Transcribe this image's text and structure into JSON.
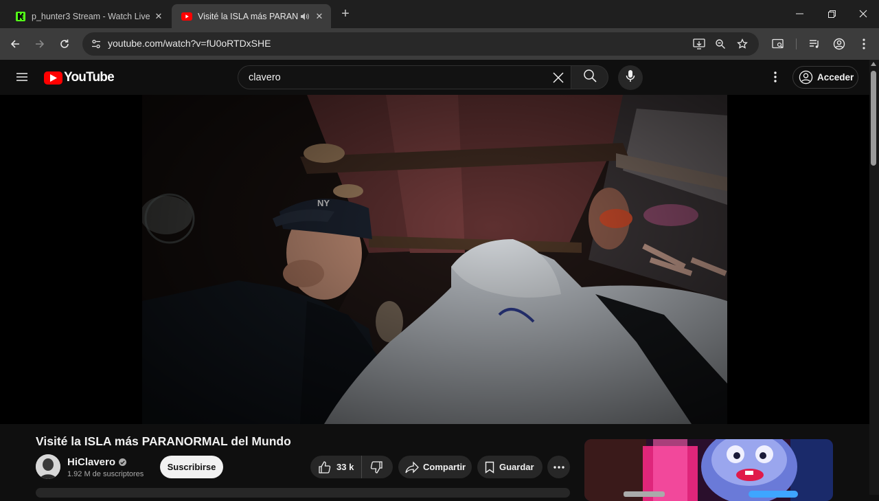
{
  "browser": {
    "tabs": [
      {
        "title": "p_hunter3 Stream - Watch Live",
        "favicon": "kick-logo-icon",
        "active": false
      },
      {
        "title": "Visité la ISLA más PARANORMAL",
        "favicon": "youtube-logo-icon",
        "active": true,
        "audio": true
      }
    ],
    "address": "youtube.com/watch?v=fU0oRTDxSHE"
  },
  "youtube": {
    "logo_text": "YouTube",
    "search": {
      "query": "clavero"
    },
    "signin_label": "Acceder",
    "video": {
      "title": "Visité la ISLA más PARANORMAL del Mundo",
      "channel": "HiClavero",
      "subscribers": "1.92 M de suscriptores",
      "subscribe_label": "Suscribirse",
      "likes": "33 k",
      "share_label": "Compartir",
      "save_label": "Guardar"
    }
  },
  "colors": {
    "accent_red": "#ff0000",
    "chrome_dark": "#1f1f1f",
    "page_bg": "#0f0f0f",
    "link_blue": "#3ea6ff"
  }
}
